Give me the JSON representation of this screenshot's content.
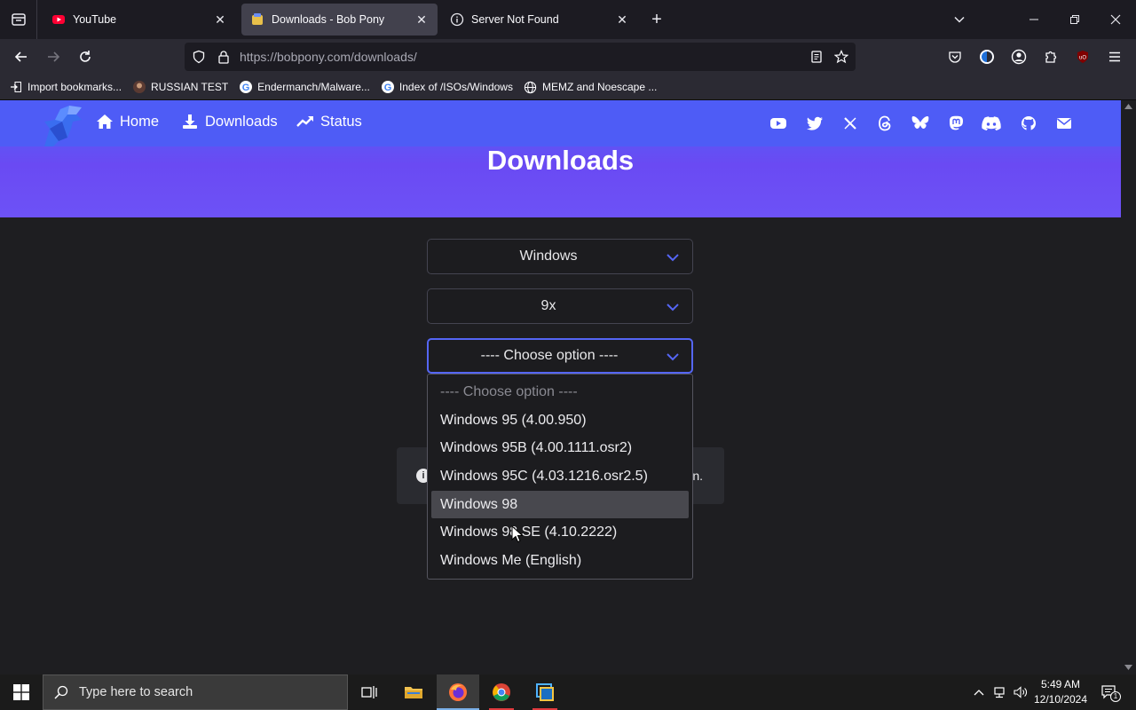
{
  "browser": {
    "tabs": [
      {
        "title": "YouTube",
        "active": false
      },
      {
        "title": "Downloads - Bob Pony",
        "active": true
      },
      {
        "title": "Server Not Found",
        "active": false
      }
    ],
    "url_host": "https://bobpony.com",
    "url_path": "/downloads/",
    "bookmarks": [
      {
        "label": "Import bookmarks...",
        "icon": "import-icon"
      },
      {
        "label": "RUSSIAN TEST",
        "icon": "github-avatar-icon"
      },
      {
        "label": "Endermanch/Malware...",
        "icon": "google-icon"
      },
      {
        "label": "Index of /ISOs/Windows",
        "icon": "google-icon"
      },
      {
        "label": "MEMZ and Noescape ...",
        "icon": "globe-icon"
      }
    ]
  },
  "site": {
    "nav": [
      {
        "label": "Home",
        "icon": "home-icon"
      },
      {
        "label": "Downloads",
        "icon": "download-icon"
      },
      {
        "label": "Status",
        "icon": "trending-icon"
      }
    ],
    "social_icons": [
      "youtube-icon",
      "twitter-icon",
      "x-icon",
      "threads-icon",
      "bluesky-icon",
      "mastodon-icon",
      "discord-icon",
      "github-icon",
      "mail-icon"
    ],
    "heading": "Downloads",
    "selects": {
      "os": "Windows",
      "family": "9x",
      "version": "---- Choose option ----"
    },
    "info_tail": "n.",
    "dropdown_options": [
      "---- Choose option ----",
      "Windows 95 (4.00.950)",
      "Windows 95B (4.00.1111.osr2)",
      "Windows 95C (4.03.1216.osr2.5)",
      "Windows 98",
      "Windows 98 SE (4.10.2222)",
      "Windows Me (English)"
    ],
    "highlighted_option_index": 4,
    "accent_color": "#4e5cf6"
  },
  "taskbar": {
    "search_placeholder": "Type here to search",
    "time": "5:49 AM",
    "date": "12/10/2024",
    "notification_count": "1"
  }
}
